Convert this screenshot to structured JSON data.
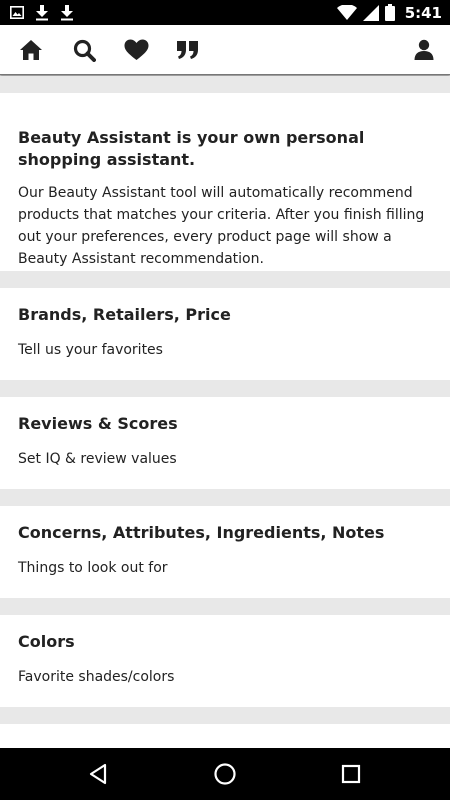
{
  "status_bar": {
    "time": "5:41",
    "icons": [
      "image-icon",
      "download-icon",
      "download-icon",
      "wifi-icon",
      "signal-icon",
      "battery-icon"
    ]
  },
  "toolbar": {
    "icons": [
      "home-icon",
      "search-icon",
      "heart-icon",
      "quote-icon",
      "user-icon"
    ]
  },
  "intro": {
    "title": "Beauty Assistant is your own personal shopping assistant.",
    "body": "Our Beauty Assistant tool will automatically recommend products that matches your criteria. After you finish filling out your preferences, every product page will show a Beauty Assistant recommendation."
  },
  "sections": [
    {
      "title": "Brands, Retailers, Price",
      "subtitle": "Tell us your favorites"
    },
    {
      "title": "Reviews & Scores",
      "subtitle": "Set IQ & review values"
    },
    {
      "title": "Concerns, Attributes, Ingredients, Notes",
      "subtitle": "Things to look out for"
    },
    {
      "title": "Colors",
      "subtitle": "Favorite shades/colors"
    }
  ],
  "nav_bar": {
    "icons": [
      "back-icon",
      "home-circle-icon",
      "recents-icon"
    ]
  },
  "colors": {
    "background": "#e8e8e8",
    "card": "#ffffff",
    "text": "#222222",
    "bars": "#000000"
  }
}
